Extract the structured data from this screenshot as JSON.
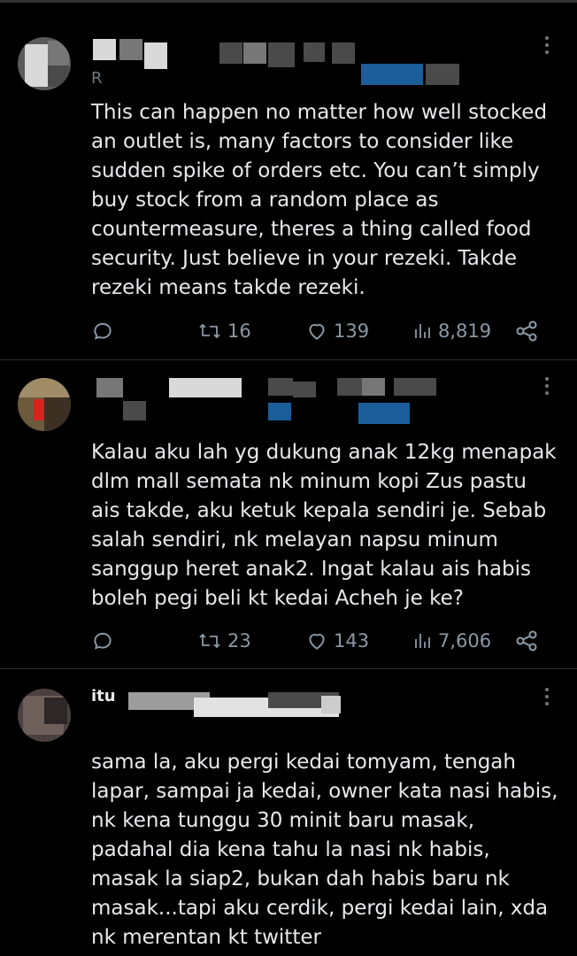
{
  "tweets": [
    {
      "name_fragment": "R",
      "text": "This can happen no matter how well stocked an outlet is, many factors to consider like sudden spike of orders etc. You can’t simply buy stock from a random place as countermeasure, theres a thing called food security. Just believe in your rezeki. Takde rezeki means takde rezeki.",
      "retweets": "16",
      "likes": "139",
      "views": "8,819"
    },
    {
      "name_fragment": "",
      "text": "Kalau aku lah yg dukung anak 12kg menapak dlm mall semata nk minum kopi Zus pastu ais takde, aku ketuk kepala sendiri je. Sebab salah sendiri, nk melayan napsu minum sanggup heret anak2. Ingat kalau ais habis boleh pegi beli kt kedai Acheh je ke?",
      "retweets": "23",
      "likes": "143",
      "views": "7,606"
    },
    {
      "name_fragment": "itu",
      "text": "sama la, aku pergi kedai tomyam, tengah lapar, sampai ja kedai, owner kata nasi habis, nk kena tunggu 30 minit baru masak, padahal dia kena tahu la nasi nk habis, masak la siap2, bukan dah habis baru nk masak...tapi aku cerdik, pergi kedai lain, xda nk merentan kt twitter"
    }
  ],
  "icons": {
    "reply": "reply-icon",
    "retweet": "retweet-icon",
    "like": "heart-icon",
    "views": "views-icon",
    "share": "share-icon",
    "more": "more-icon"
  },
  "colors": {
    "background": "#000000",
    "text": "#e7e9ea",
    "muted": "#71767b",
    "divider": "#2f3336"
  }
}
